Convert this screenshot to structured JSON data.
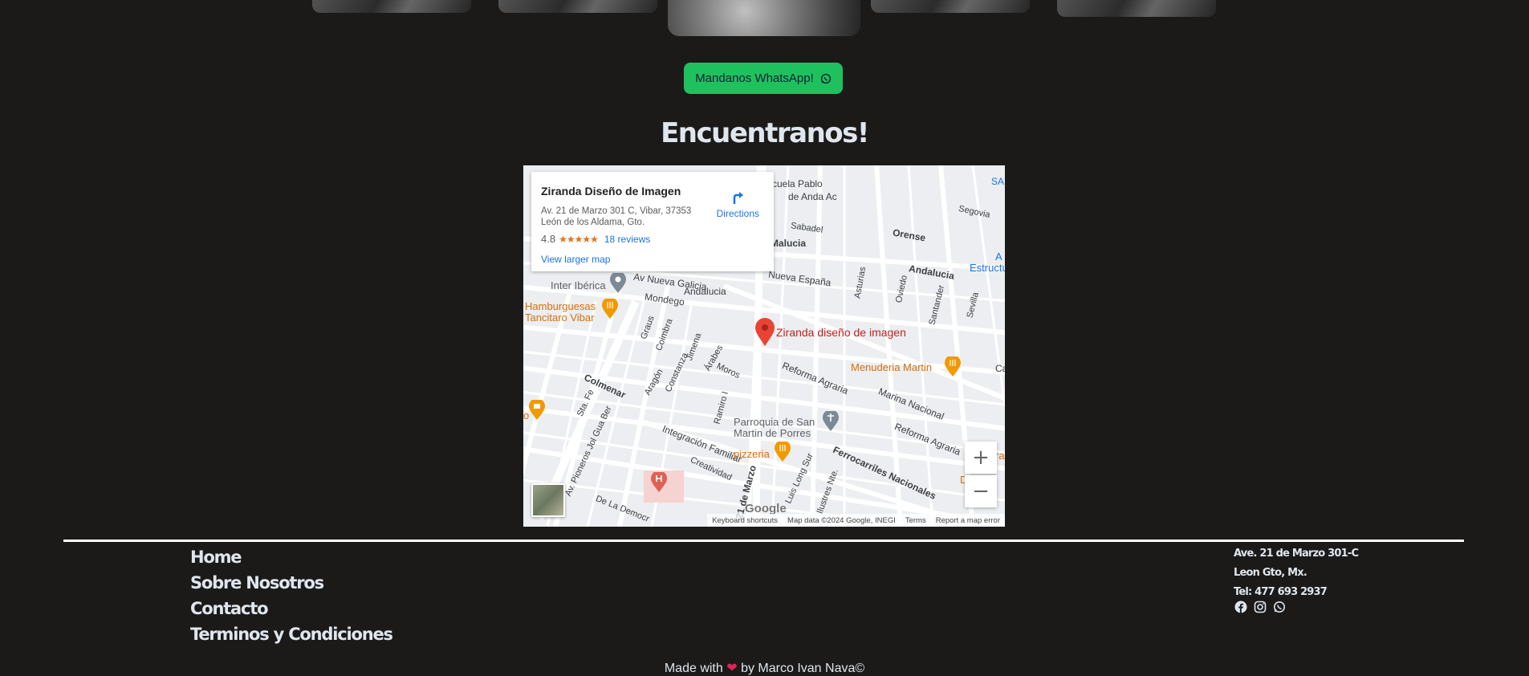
{
  "gallery": {
    "thumbnails": [
      "photo-1",
      "photo-2",
      "photo-3",
      "photo-4",
      "photo-5"
    ]
  },
  "whatsapp_button": {
    "label": "Mandanos WhatsApp!",
    "icon": "whatsapp-icon",
    "color": "#1fc15e"
  },
  "section_title": "Encuentranos!",
  "map": {
    "place_name": "Ziranda Diseño de Imagen",
    "address_line1": "Av. 21 de Marzo 301 C, Vibar, 37353",
    "address_line2": "León de los Aldama, Gto.",
    "rating": "4.8",
    "stars": "★★★★★",
    "reviews": "18 reviews",
    "directions_label": "Directions",
    "view_larger": "View larger map",
    "pin_label": "Ziranda diseño de imagen",
    "labels": {
      "escuela": "cuela Pablo",
      "escuela2": "de Anda Ac",
      "segovia": "Segovia",
      "orense": "Orense",
      "sabadel": "Sabadel",
      "malucia": "Malucia",
      "andalucia1": "Andalucia",
      "andalucia2": "Andalucia",
      "nueva_espana": "Nueva España",
      "estructu": "Estructu",
      "sa": "SA",
      "inter_iberica": "Inter Ibérica",
      "av_nueva_galicia": "Av Nueva Galicia",
      "mondego": "Mondego",
      "hamburguesas1": "Hamburguesas",
      "hamburguesas2": "Tancitaro Vibar",
      "menuderia": "Menuderia Martin",
      "colmenar": "Colmenar",
      "reforma_agraria1": "Reforma Agraria",
      "reforma_agraria2": "Reforma Agraria",
      "marina_nacional": "Marina Nacional",
      "parroquia1": "Parroquia de San",
      "parroquia2": "Martin de Porres",
      "pizzeria": "pizzeria",
      "integracion": "Integración Familiar",
      "creatividad": "Creatividad",
      "ferrocarriles": "Ferrocarriles Nacionales",
      "av_pioneros": "Av. Pioneros Jol Gua Ber",
      "de_la_democracia": "De La Democr",
      "marzo21": "21 de Marzo",
      "luis_long": "Luis Long Sur",
      "ilustres": "Ilustres Nte.",
      "sta_fe": "Sta. Fe",
      "aragon": "Aragón",
      "constanza": "Constanza",
      "jimena": "Jimena",
      "arabes": "Árabes",
      "moros": "Moros",
      "ramiro": "Ramiro I",
      "graus": "Graus",
      "coimbra": "Coimbra",
      "asturias": "Asturias",
      "oviedo": "Oviedo",
      "santander": "Santander",
      "sevilla": "Sevilla",
      "ca": "Ca",
      "d": "D",
      "a": "A",
      "ra": "ra",
      "o": "o"
    },
    "zoom_in": "+",
    "zoom_out": "−",
    "google": "Google",
    "attribution": {
      "shortcuts": "Keyboard shortcuts",
      "data": "Map data ©2024 Google, INEGI",
      "terms": "Terms",
      "report": "Report a map error"
    }
  },
  "footer": {
    "nav": [
      "Home",
      "Sobre Nosotros",
      "Contacto",
      "Terminos y Condiciones"
    ],
    "address": "Ave. 21 de Marzo 301-C",
    "city": "Leon Gto, Mx.",
    "phone": "Tel: 477 693 2937",
    "socials": [
      "facebook-icon",
      "instagram-icon",
      "whatsapp-icon"
    ],
    "made_with": "Made with",
    "heart": "❤",
    "made_by": "by Marco Ivan Nava©"
  }
}
